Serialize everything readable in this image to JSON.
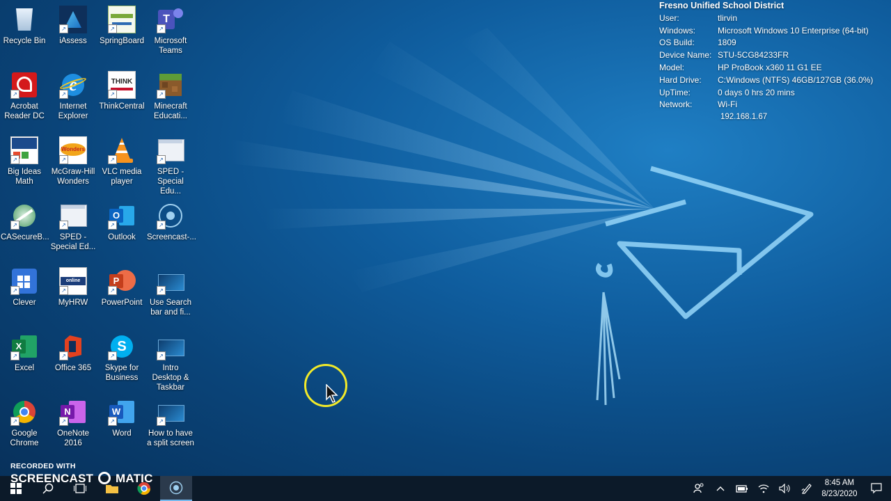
{
  "desktop": {
    "icons": [
      {
        "label": "Recycle Bin",
        "icon": "recycle-bin-icon"
      },
      {
        "label": "iAssess",
        "icon": "iassess-icon"
      },
      {
        "label": "SpringBoard",
        "icon": "springboard-icon"
      },
      {
        "label": "Microsoft Teams",
        "icon": "teams-icon"
      },
      {
        "label": "Acrobat Reader DC",
        "icon": "acrobat-icon"
      },
      {
        "label": "Internet Explorer",
        "icon": "internet-explorer-icon"
      },
      {
        "label": "ThinkCentral",
        "icon": "thinkcentral-icon"
      },
      {
        "label": "Minecraft Educati...",
        "icon": "minecraft-icon"
      },
      {
        "label": "Big Ideas Math",
        "icon": "big-ideas-math-icon"
      },
      {
        "label": "McGraw-Hill Wonders",
        "icon": "wonders-icon"
      },
      {
        "label": "VLC media player",
        "icon": "vlc-icon"
      },
      {
        "label": "SPED - Special Edu...",
        "icon": "sped-window-icon"
      },
      {
        "label": "CASecureB...",
        "icon": "casecure-browser-icon"
      },
      {
        "label": "SPED - Special Ed...",
        "icon": "sped-window-icon"
      },
      {
        "label": "Outlook",
        "icon": "outlook-icon"
      },
      {
        "label": "Screencast-...",
        "icon": "screencast-icon"
      },
      {
        "label": "Clever",
        "icon": "clever-icon"
      },
      {
        "label": "MyHRW",
        "icon": "myhrw-icon"
      },
      {
        "label": "PowerPoint",
        "icon": "powerpoint-icon"
      },
      {
        "label": "Use Search bar and fi...",
        "icon": "video-thumbnail-icon"
      },
      {
        "label": "Excel",
        "icon": "excel-icon"
      },
      {
        "label": "Office 365",
        "icon": "office365-icon"
      },
      {
        "label": "Skype for Business",
        "icon": "skype-icon"
      },
      {
        "label": "Intro Desktop & Taskbar",
        "icon": "video-thumbnail-icon"
      },
      {
        "label": "Google Chrome",
        "icon": "chrome-icon"
      },
      {
        "label": "OneNote 2016",
        "icon": "onenote-icon"
      },
      {
        "label": "Word",
        "icon": "word-icon"
      },
      {
        "label": "How to have a split screen",
        "icon": "video-thumbnail-icon"
      }
    ]
  },
  "sysinfo": {
    "title": "Fresno Unified School District",
    "rows": [
      {
        "key": "User:",
        "value": "tlirvin"
      },
      {
        "key": "Windows:",
        "value": "Microsoft Windows 10 Enterprise (64-bit)"
      },
      {
        "key": "OS Build:",
        "value": "1809"
      },
      {
        "key": "Device Name:",
        "value": "STU-5CG84233FR"
      },
      {
        "key": "Model:",
        "value": "HP ProBook x360 11 G1 EE"
      },
      {
        "key": "Hard Drive:",
        "value": "C:Windows (NTFS) 46GB/127GB (36.0%)"
      },
      {
        "key": "UpTime:",
        "value": "0 days 0 hrs 20 mins"
      },
      {
        "key": "Network:",
        "value": "Wi-Fi"
      }
    ],
    "ip": "192.168.1.67"
  },
  "watermark": {
    "line1": "RECORDED WITH",
    "line2": "SCREENCAST",
    "line3": "MATIC"
  },
  "taskbar": {
    "buttons": [
      "start-icon",
      "search-icon",
      "task-view-icon",
      "file-explorer-icon",
      "chrome-icon",
      "screencast-icon"
    ],
    "clock_time": "8:45 AM",
    "clock_date": "8/23/2020"
  },
  "colors": {
    "accent": "#76b9ed",
    "cursor_ring": "#f2ea29",
    "taskbar": "#0c1a29"
  }
}
